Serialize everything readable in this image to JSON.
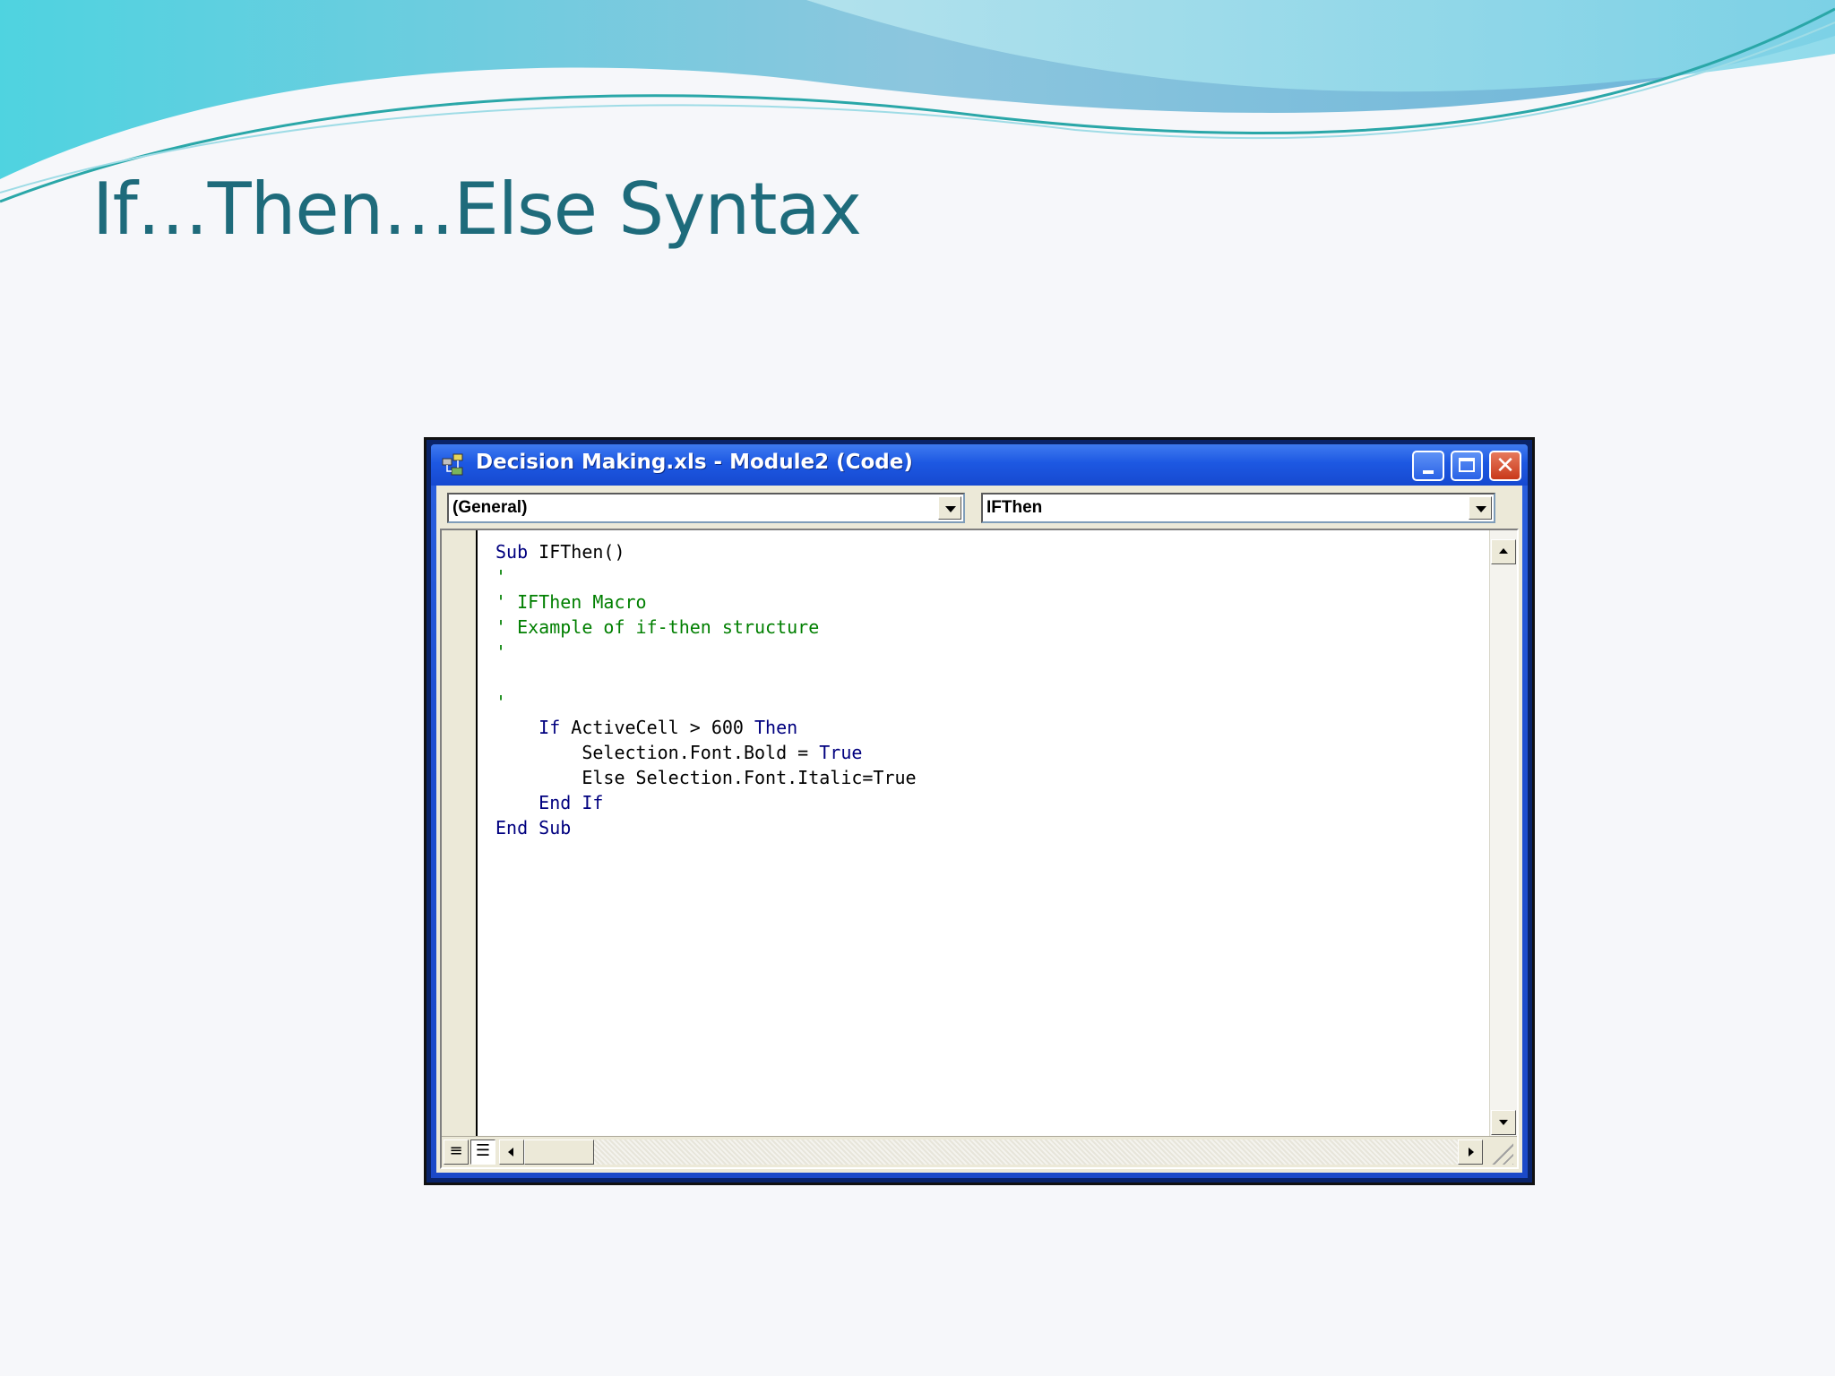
{
  "slide": {
    "title": "If…Then…Else Syntax"
  },
  "window": {
    "title": "Decision Making.xls - Module2 (Code)",
    "close_glyph": "✕",
    "object_dropdown": {
      "selected": "(General)"
    },
    "procedure_dropdown": {
      "selected": "IFThen"
    }
  },
  "code": {
    "lines": [
      [
        {
          "t": "Sub ",
          "c": "kw"
        },
        {
          "t": "IFThen()",
          "c": "tx"
        }
      ],
      [
        {
          "t": "'",
          "c": "cm"
        }
      ],
      [
        {
          "t": "' IFThen Macro",
          "c": "cm"
        }
      ],
      [
        {
          "t": "' Example of if-then structure",
          "c": "cm"
        }
      ],
      [
        {
          "t": "'",
          "c": "cm"
        }
      ],
      [],
      [
        {
          "t": "'",
          "c": "cm"
        }
      ],
      [
        {
          "t": "    ",
          "c": "tx"
        },
        {
          "t": "If ",
          "c": "kw"
        },
        {
          "t": "ActiveCell > 600 ",
          "c": "tx"
        },
        {
          "t": "Then",
          "c": "kw"
        }
      ],
      [
        {
          "t": "        Selection.Font.Bold = ",
          "c": "tx"
        },
        {
          "t": "True",
          "c": "kw"
        }
      ],
      [
        {
          "t": "        Else Selection.Font.Italic=True",
          "c": "tx"
        }
      ],
      [
        {
          "t": "    ",
          "c": "tx"
        },
        {
          "t": "End If",
          "c": "kw"
        }
      ],
      [
        {
          "t": "End Sub",
          "c": "kw"
        }
      ]
    ]
  },
  "colors": {
    "title_text": "#1e6b7b",
    "keyword": "#00007f",
    "comment": "#007f00",
    "titlebar": "#1d58e2"
  },
  "icons": {
    "app": "vbe-code-icon",
    "view_procedure": "procedure-view-icon",
    "view_module": "full-module-view-icon"
  }
}
